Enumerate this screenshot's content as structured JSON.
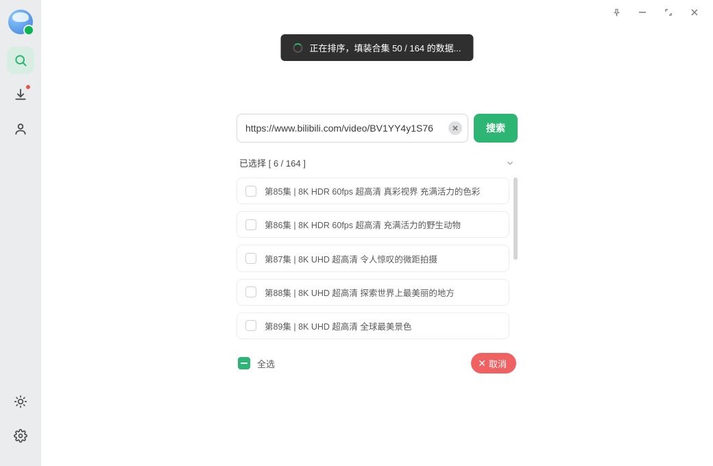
{
  "toast": {
    "text": "正在排序，填装合集 50 / 164 的数据..."
  },
  "search": {
    "value": "https://www.bilibili.com/video/BV1YY4y1S76",
    "button": "搜索"
  },
  "selection": {
    "label": "已选择 [ 6 / 164 ]"
  },
  "items": [
    {
      "label": "第85集 | 8K HDR 60fps 超高清 真彩视界 充满活力的色彩"
    },
    {
      "label": "第86集 | 8K HDR 60fps 超高清 充满活力的野生动物"
    },
    {
      "label": "第87集 | 8K UHD 超高清 令人惊叹的微距拍摄"
    },
    {
      "label": "第88集 | 8K UHD 超高清 探索世界上最美丽的地方"
    },
    {
      "label": "第89集 | 8K UHD 超高清 全球最美景色"
    }
  ],
  "footer": {
    "selectAll": "全选",
    "cancel": "取消"
  }
}
